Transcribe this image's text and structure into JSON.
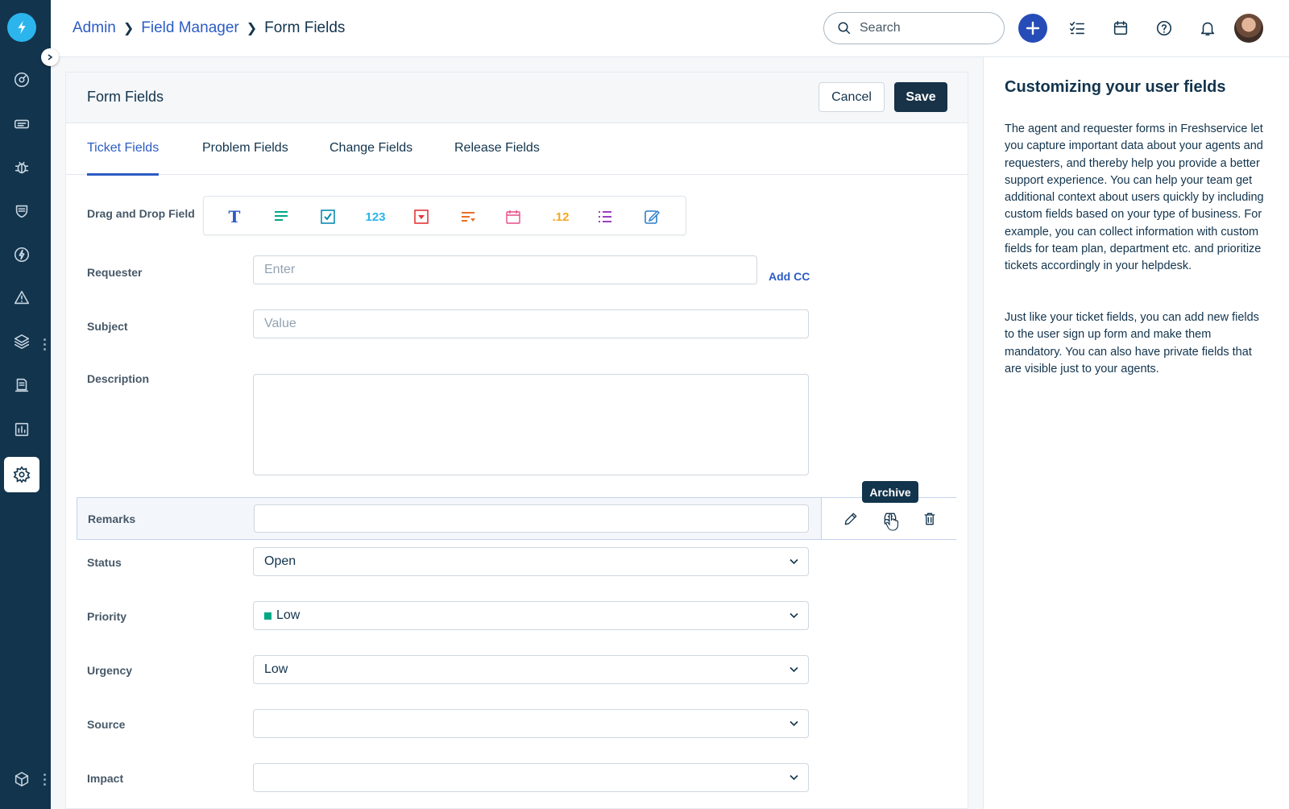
{
  "breadcrumb": {
    "items": [
      "Admin",
      "Field Manager"
    ],
    "current": "Form Fields"
  },
  "header": {
    "search_placeholder": "Search"
  },
  "card": {
    "title": "Form Fields",
    "cancel_label": "Cancel",
    "save_label": "Save"
  },
  "tabs": [
    {
      "label": "Ticket Fields",
      "active": true
    },
    {
      "label": "Problem Fields",
      "active": false
    },
    {
      "label": "Change Fields",
      "active": false
    },
    {
      "label": "Release Fields",
      "active": false
    }
  ],
  "drag_drop": {
    "label": "Drag and Drop Field",
    "tools": [
      {
        "icon": "text-field-icon",
        "glyph": "T",
        "color": "#2c5cc5"
      },
      {
        "icon": "paragraph-field-icon",
        "color": "#00a886"
      },
      {
        "icon": "checkbox-field-icon",
        "color": "#0b8bb0"
      },
      {
        "icon": "number-field-icon",
        "glyph": "123",
        "color": "#2bb5ec"
      },
      {
        "icon": "dropdown-field-icon",
        "color": "#e43538"
      },
      {
        "icon": "dependent-field-icon",
        "color": "#e86f25"
      },
      {
        "icon": "date-field-icon",
        "color": "#e64b87"
      },
      {
        "icon": "decimal-field-icon",
        "glyph": ".12",
        "color": "#f5a623"
      },
      {
        "icon": "multi-select-field-icon",
        "color": "#9b3fc1"
      },
      {
        "icon": "rich-text-field-icon",
        "color": "#2c7ecb"
      }
    ]
  },
  "fields": {
    "requester": {
      "label": "Requester",
      "placeholder": "Enter",
      "add_cc": "Add CC"
    },
    "subject": {
      "label": "Subject",
      "placeholder": "Value"
    },
    "description": {
      "label": "Description"
    },
    "remarks": {
      "label": "Remarks",
      "tooltip": "Archive"
    },
    "status": {
      "label": "Status",
      "value": "Open"
    },
    "priority": {
      "label": "Priority",
      "value": "Low",
      "color": "#00a886"
    },
    "urgency": {
      "label": "Urgency",
      "value": "Low"
    },
    "source": {
      "label": "Source",
      "value": ""
    },
    "impact": {
      "label": "Impact",
      "value": ""
    }
  },
  "help": {
    "title": "Customizing your user fields",
    "para1": "The agent and requester forms in Freshservice let you capture important data about your agents and requesters, and thereby help you provide a better support experience. You can help your team get additional context about users quickly by including custom fields based on your type of business. For example, you can collect information with custom fields for team plan, department etc. and prioritize tickets accordingly in your helpdesk.",
    "para2": "Just like your ticket fields, you can add new fields to the user sign up form and make them mandatory. You can also have private fields that are visible just to your agents."
  },
  "colors": {
    "sidebar": "#12344d",
    "accent": "#2c5cc5",
    "logo": "#2bb5ec"
  }
}
